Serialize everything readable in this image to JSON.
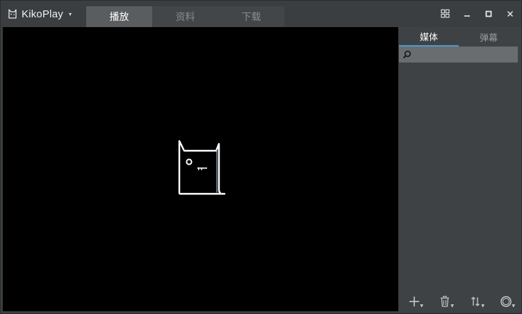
{
  "app": {
    "name": "KikoPlay",
    "menu_caret": "▾"
  },
  "main_tabs": [
    {
      "label": "播放",
      "active": true
    },
    {
      "label": "资料",
      "active": false
    },
    {
      "label": "下载",
      "active": false
    }
  ],
  "window_controls": [
    {
      "icon": "grid-icon"
    },
    {
      "icon": "minimize-icon"
    },
    {
      "icon": "maximize-icon"
    },
    {
      "icon": "close-icon"
    }
  ],
  "side_panel": {
    "tabs": [
      {
        "label": "媒体",
        "active": true
      },
      {
        "label": "弹幕",
        "active": false
      }
    ],
    "search": {
      "value": "",
      "placeholder": ""
    },
    "toolbar": [
      {
        "icon": "add-icon",
        "has_menu": true
      },
      {
        "icon": "trash-icon",
        "has_menu": true
      },
      {
        "icon": "sort-icon",
        "has_menu": true
      },
      {
        "icon": "circle-icon",
        "has_menu": true
      }
    ]
  },
  "colors": {
    "background": "#3b3e40",
    "tab_active": "#5a5d5f",
    "tab_inactive": "#434648",
    "player": "#000000",
    "accent": "#4a9ad6",
    "search_bar": "#6a6d6f"
  }
}
